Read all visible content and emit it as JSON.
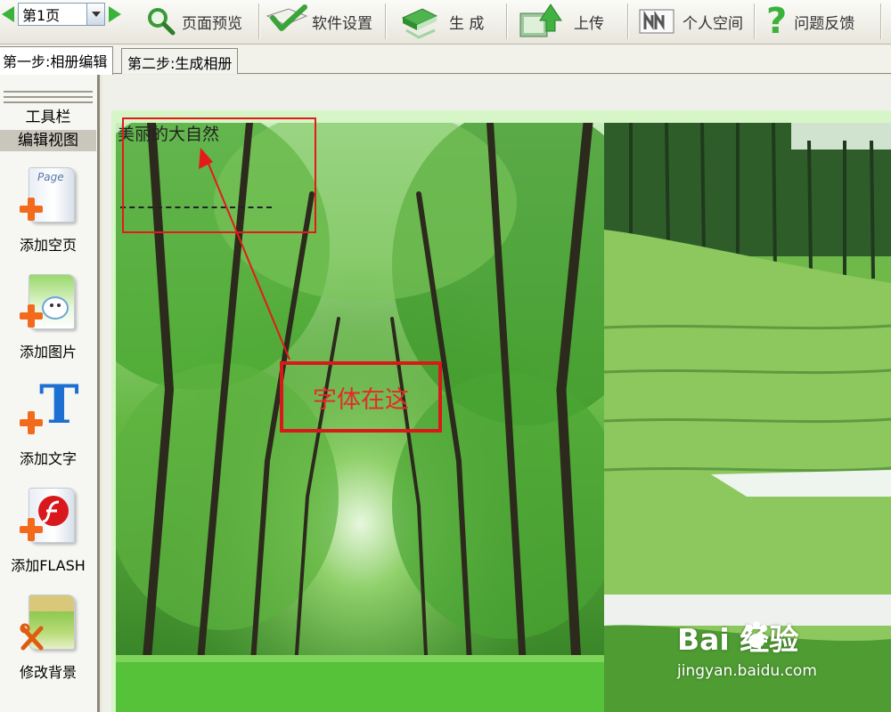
{
  "toolbar": {
    "page_value": "第1页",
    "buttons": {
      "preview": "页面预览",
      "settings": "软件设置",
      "generate": "生 成",
      "upload": "上传",
      "personal": "个人空间",
      "feedback": "问题反馈"
    }
  },
  "tabs": {
    "step1": "第一步:相册编辑",
    "step2": "第二步:生成相册"
  },
  "sidebar": {
    "toolbar_label": "工具栏",
    "edit_view_label": "编辑视图",
    "items": {
      "add_blank": "添加空页",
      "add_image": "添加图片",
      "add_text": "添加文字",
      "add_flash": "添加FLASH",
      "edit_bg": "修改背景"
    },
    "page_icon_text": "Page"
  },
  "canvas": {
    "overlay_text": "美丽的大自然",
    "annotation_label": "字体在这"
  },
  "watermark": {
    "brand": "Bai  经验",
    "url": "jingyan.baidu.com"
  },
  "colors": {
    "accent_green": "#3bb33b",
    "annotation_red": "#e41a1a",
    "canvas_bg": "#d6f6c8"
  }
}
